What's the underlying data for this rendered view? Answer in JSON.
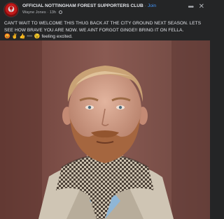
{
  "post": {
    "group_name": "OFFICIAL NOTTINGHAM FOREST SUPPORTERS CLUB",
    "separator": "·",
    "join_label": "Join",
    "author": "Wayne Jones",
    "time": "13h",
    "meta_separator": "·",
    "text": "CAN'T WAIT TO WELCOME THIS THUG BACK AT THE CITY GROUND NEXT SEASON. LETS SEE HOW BRAVE YOU ARE NOW. WE AINT FORGOT GINGE!! BRING IT ON FELLA.",
    "emojis": "😡 ✌️ 👍 ➖",
    "feeling_emoji": "😉",
    "feeling_text": "feeling excited.",
    "more_icon_glyph": "•••",
    "close_icon_glyph": "✕"
  },
  "photo": {
    "subject": "man-with-beard-and-scarf"
  },
  "colors": {
    "background": "#242526",
    "link_blue": "#4599ff",
    "secondary_text": "#b0b3b8"
  }
}
